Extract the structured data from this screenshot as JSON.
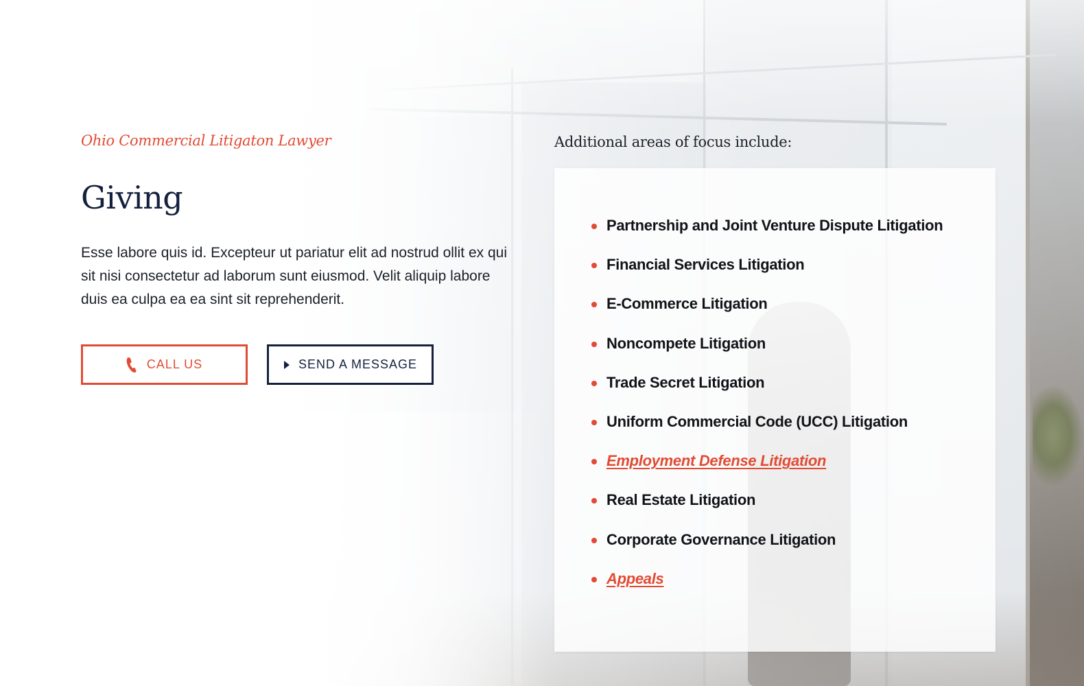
{
  "intro": {
    "eyebrow": "Ohio Commercial Litigaton Lawyer",
    "title": "Giving",
    "body": "Esse labore quis id. Excepteur ut pariatur elit ad nostrud ollit ex qui sit nisi consectetur ad laborum sunt eiusmod. Velit aliquip labore duis ea culpa ea ea sint sit reprehenderit."
  },
  "buttons": {
    "call_label": "CALL US",
    "call_icon": "phone-icon",
    "message_label": "SEND A MESSAGE",
    "message_icon": "play-triangle-icon"
  },
  "focus": {
    "heading": "Additional areas of focus include:",
    "items": [
      {
        "label": "Partnership and Joint Venture Dispute Litigation",
        "is_link": false
      },
      {
        "label": "Financial Services Litigation",
        "is_link": false
      },
      {
        "label": "E-Commerce Litigation",
        "is_link": false
      },
      {
        "label": "Noncompete Litigation",
        "is_link": false
      },
      {
        "label": "Trade Secret Litigation",
        "is_link": false
      },
      {
        "label": "Uniform Commercial Code (UCC) Litigation",
        "is_link": false
      },
      {
        "label": "Employment Defense Litigation",
        "is_link": true
      },
      {
        "label": "Real Estate Litigation",
        "is_link": false
      },
      {
        "label": "Corporate Governance Litigation",
        "is_link": false
      },
      {
        "label": "Appeals",
        "is_link": true
      }
    ]
  },
  "colors": {
    "accent": "#e24a33",
    "navy": "#14213d",
    "text": "#1b1f27"
  }
}
